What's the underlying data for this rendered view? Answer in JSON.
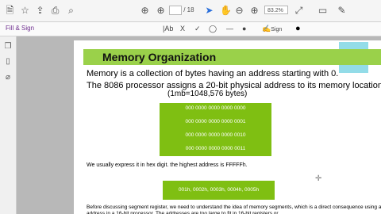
{
  "toolbar": {
    "page_current": "",
    "page_total": "/ 18",
    "zoom": "83.2%"
  },
  "signbar": {
    "label": "Fill & Sign",
    "text_tool": "|Ab",
    "x_tool": "X",
    "check_tool": "✓",
    "sign_label": "Sign"
  },
  "slide": {
    "title": "Memory Organization",
    "line1": "Memory is a collection of bytes having an address starting with 0.",
    "line2": "The 8086 processor assigns a 20-bit physical address to its memory locations",
    "line3": "(1mb=1048,576 bytes)",
    "addresses": [
      "000 0000 0000 0000 0000",
      "000 0000 0000 0000 0001",
      "000 0000 0000 0000 0010",
      "000 0000 0000 0000 0011"
    ],
    "hex_note": "We usually express it in hex digit. the highest address is FFFFFh.",
    "hex_examples": "001h, 0002h, 0003h, 0004h, 0005h",
    "bottom_para": "Before discussing segment register, we need to understand the idea of memory segments, which is a direct consequence using a 20-bit address in a 16-bit processor. The addresses are too large to fit in 16-bit registers or"
  }
}
